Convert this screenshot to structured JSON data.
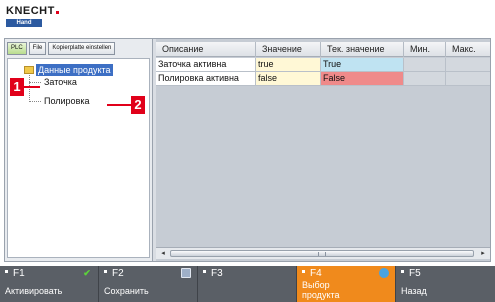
{
  "header": {
    "logo_text": "KNECHT",
    "logo_sub": "Hand"
  },
  "left_panel": {
    "toolbar": {
      "plc_label": "PLC",
      "file_label": "File",
      "kopierplatte_label": "Kopierplatte einstellen"
    },
    "tree": {
      "root": "Данные продукта",
      "children": [
        "Заточка",
        "Полировка"
      ]
    }
  },
  "callouts": [
    "1",
    "2"
  ],
  "grid": {
    "headers": [
      "Описание",
      "Значение",
      "Тек. значение",
      "Мин.",
      "Макс."
    ],
    "rows": [
      {
        "description": "Заточка активна",
        "value": "true",
        "current": "True",
        "current_status": "ok",
        "min": "",
        "max": ""
      },
      {
        "description": "Полировка активна",
        "value": "false",
        "current": "False",
        "current_status": "bad",
        "min": "",
        "max": ""
      }
    ]
  },
  "function_keys": [
    {
      "key": "F1",
      "label": "Активировать",
      "icon": "check-icon",
      "active": false
    },
    {
      "key": "F2",
      "label": "Сохранить",
      "icon": "save-icon",
      "active": false
    },
    {
      "key": "F3",
      "label": "",
      "icon": "",
      "active": false
    },
    {
      "key": "F4",
      "label": "Выбор продукта",
      "icon": "globe-icon",
      "active": true
    },
    {
      "key": "F5",
      "label": "Назад",
      "icon": "",
      "active": false
    }
  ],
  "colors": {
    "accent": "#e1001a",
    "tree_selection": "#3d6fc4",
    "current_ok": "#bfe3f2",
    "current_bad": "#ef8a8a",
    "value_cell": "#fff8d6",
    "fkey_active": "#f08a1c",
    "fkey_bar": "#5a5f66"
  }
}
